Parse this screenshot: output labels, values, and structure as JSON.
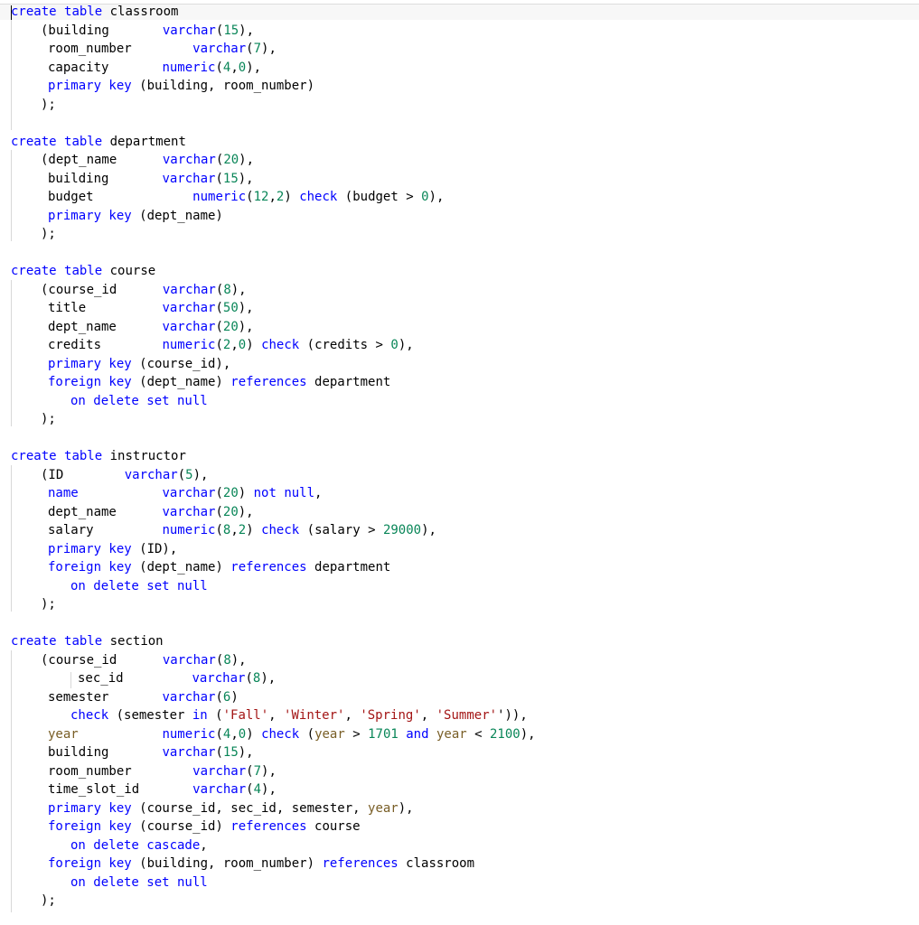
{
  "colors": {
    "background": "#ffffff",
    "text": "#000000",
    "keyword": "#0000ff",
    "number": "#098658",
    "string": "#a31515",
    "variable": "#795e26",
    "indent_guide": "#d8d8d8"
  },
  "editor": {
    "language": "sql",
    "lines": [
      {
        "x": 12,
        "tokens": [
          [
            "kw",
            "create"
          ],
          [
            "txt",
            " "
          ],
          [
            "kw",
            "table"
          ],
          [
            "txt",
            " classroom"
          ]
        ]
      },
      {
        "x": 45,
        "tokens": [
          [
            "txt",
            "(building       "
          ],
          [
            "kw",
            "varchar"
          ],
          [
            "txt",
            "("
          ],
          [
            "num",
            "15"
          ],
          [
            "txt",
            "),"
          ]
        ]
      },
      {
        "x": 53,
        "tokens": [
          [
            "txt",
            "room_number        "
          ],
          [
            "kw",
            "varchar"
          ],
          [
            "txt",
            "("
          ],
          [
            "num",
            "7"
          ],
          [
            "txt",
            "),"
          ]
        ]
      },
      {
        "x": 53,
        "tokens": [
          [
            "txt",
            "capacity       "
          ],
          [
            "kw",
            "numeric"
          ],
          [
            "txt",
            "("
          ],
          [
            "num",
            "4"
          ],
          [
            "txt",
            ","
          ],
          [
            "num",
            "0"
          ],
          [
            "txt",
            "),"
          ]
        ]
      },
      {
        "x": 53,
        "tokens": [
          [
            "kw",
            "primary key"
          ],
          [
            "txt",
            " (building, room_number)"
          ]
        ]
      },
      {
        "x": 45,
        "tokens": [
          [
            "txt",
            ");"
          ]
        ]
      },
      {
        "x": 12,
        "tokens": []
      },
      {
        "x": 12,
        "tokens": [
          [
            "kw",
            "create"
          ],
          [
            "txt",
            " "
          ],
          [
            "kw",
            "table"
          ],
          [
            "txt",
            " department"
          ]
        ]
      },
      {
        "x": 45,
        "tokens": [
          [
            "txt",
            "(dept_name      "
          ],
          [
            "kw",
            "varchar"
          ],
          [
            "txt",
            "("
          ],
          [
            "num",
            "20"
          ],
          [
            "txt",
            "),"
          ]
        ]
      },
      {
        "x": 53,
        "tokens": [
          [
            "txt",
            "building       "
          ],
          [
            "kw",
            "varchar"
          ],
          [
            "txt",
            "("
          ],
          [
            "num",
            "15"
          ],
          [
            "txt",
            "),"
          ]
        ]
      },
      {
        "x": 53,
        "tokens": [
          [
            "txt",
            "budget             "
          ],
          [
            "kw",
            "numeric"
          ],
          [
            "txt",
            "("
          ],
          [
            "num",
            "12"
          ],
          [
            "txt",
            ","
          ],
          [
            "num",
            "2"
          ],
          [
            "txt",
            ") "
          ],
          [
            "kw",
            "check"
          ],
          [
            "txt",
            " (budget > "
          ],
          [
            "num",
            "0"
          ],
          [
            "txt",
            "),"
          ]
        ]
      },
      {
        "x": 53,
        "tokens": [
          [
            "kw",
            "primary key"
          ],
          [
            "txt",
            " (dept_name)"
          ]
        ]
      },
      {
        "x": 45,
        "tokens": [
          [
            "txt",
            ");"
          ]
        ]
      },
      {
        "x": 12,
        "tokens": []
      },
      {
        "x": 12,
        "tokens": [
          [
            "kw",
            "create"
          ],
          [
            "txt",
            " "
          ],
          [
            "kw",
            "table"
          ],
          [
            "txt",
            " course"
          ]
        ]
      },
      {
        "x": 45,
        "tokens": [
          [
            "txt",
            "(course_id      "
          ],
          [
            "kw",
            "varchar"
          ],
          [
            "txt",
            "("
          ],
          [
            "num",
            "8"
          ],
          [
            "txt",
            "),"
          ]
        ]
      },
      {
        "x": 53,
        "tokens": [
          [
            "txt",
            "title          "
          ],
          [
            "kw",
            "varchar"
          ],
          [
            "txt",
            "("
          ],
          [
            "num",
            "50"
          ],
          [
            "txt",
            "),"
          ]
        ]
      },
      {
        "x": 53,
        "tokens": [
          [
            "txt",
            "dept_name      "
          ],
          [
            "kw",
            "varchar"
          ],
          [
            "txt",
            "("
          ],
          [
            "num",
            "20"
          ],
          [
            "txt",
            "),"
          ]
        ]
      },
      {
        "x": 53,
        "tokens": [
          [
            "txt",
            "credits        "
          ],
          [
            "kw",
            "numeric"
          ],
          [
            "txt",
            "("
          ],
          [
            "num",
            "2"
          ],
          [
            "txt",
            ","
          ],
          [
            "num",
            "0"
          ],
          [
            "txt",
            ") "
          ],
          [
            "kw",
            "check"
          ],
          [
            "txt",
            " (credits > "
          ],
          [
            "num",
            "0"
          ],
          [
            "txt",
            "),"
          ]
        ]
      },
      {
        "x": 53,
        "tokens": [
          [
            "kw",
            "primary key"
          ],
          [
            "txt",
            " (course_id),"
          ]
        ]
      },
      {
        "x": 53,
        "tokens": [
          [
            "kw",
            "foreign key"
          ],
          [
            "txt",
            " (dept_name) "
          ],
          [
            "kw",
            "references"
          ],
          [
            "txt",
            " department"
          ]
        ]
      },
      {
        "x": 78,
        "tokens": [
          [
            "kw",
            "on delete set null"
          ]
        ]
      },
      {
        "x": 45,
        "tokens": [
          [
            "txt",
            ");"
          ]
        ]
      },
      {
        "x": 12,
        "tokens": []
      },
      {
        "x": 12,
        "tokens": [
          [
            "kw",
            "create"
          ],
          [
            "txt",
            " "
          ],
          [
            "kw",
            "table"
          ],
          [
            "txt",
            " instructor"
          ]
        ]
      },
      {
        "x": 45,
        "tokens": [
          [
            "txt",
            "(ID        "
          ],
          [
            "kw",
            "varchar"
          ],
          [
            "txt",
            "("
          ],
          [
            "num",
            "5"
          ],
          [
            "txt",
            "),"
          ]
        ]
      },
      {
        "x": 53,
        "tokens": [
          [
            "kw",
            "name"
          ],
          [
            "txt",
            "           "
          ],
          [
            "kw",
            "varchar"
          ],
          [
            "txt",
            "("
          ],
          [
            "num",
            "20"
          ],
          [
            "txt",
            ") "
          ],
          [
            "kw",
            "not null"
          ],
          [
            "txt",
            ","
          ]
        ]
      },
      {
        "x": 53,
        "tokens": [
          [
            "txt",
            "dept_name      "
          ],
          [
            "kw",
            "varchar"
          ],
          [
            "txt",
            "("
          ],
          [
            "num",
            "20"
          ],
          [
            "txt",
            "),"
          ]
        ]
      },
      {
        "x": 53,
        "tokens": [
          [
            "txt",
            "salary         "
          ],
          [
            "kw",
            "numeric"
          ],
          [
            "txt",
            "("
          ],
          [
            "num",
            "8"
          ],
          [
            "txt",
            ","
          ],
          [
            "num",
            "2"
          ],
          [
            "txt",
            ") "
          ],
          [
            "kw",
            "check"
          ],
          [
            "txt",
            " (salary > "
          ],
          [
            "num",
            "29000"
          ],
          [
            "txt",
            "),"
          ]
        ]
      },
      {
        "x": 53,
        "tokens": [
          [
            "kw",
            "primary key"
          ],
          [
            "txt",
            " (ID),"
          ]
        ]
      },
      {
        "x": 53,
        "tokens": [
          [
            "kw",
            "foreign key"
          ],
          [
            "txt",
            " (dept_name) "
          ],
          [
            "kw",
            "references"
          ],
          [
            "txt",
            " department"
          ]
        ]
      },
      {
        "x": 78,
        "tokens": [
          [
            "kw",
            "on delete set null"
          ]
        ]
      },
      {
        "x": 45,
        "tokens": [
          [
            "txt",
            ");"
          ]
        ]
      },
      {
        "x": 12,
        "tokens": []
      },
      {
        "x": 12,
        "tokens": [
          [
            "kw",
            "create"
          ],
          [
            "txt",
            " "
          ],
          [
            "kw",
            "table"
          ],
          [
            "txt",
            " section"
          ]
        ]
      },
      {
        "x": 45,
        "tokens": [
          [
            "txt",
            "(course_id      "
          ],
          [
            "kw",
            "varchar"
          ],
          [
            "txt",
            "("
          ],
          [
            "num",
            "8"
          ],
          [
            "txt",
            "),"
          ]
        ]
      },
      {
        "x": 86,
        "tokens": [
          [
            "txt",
            "sec_id         "
          ],
          [
            "kw",
            "varchar"
          ],
          [
            "txt",
            "("
          ],
          [
            "num",
            "8"
          ],
          [
            "txt",
            "),"
          ]
        ]
      },
      {
        "x": 53,
        "tokens": [
          [
            "txt",
            "semester       "
          ],
          [
            "kw",
            "varchar"
          ],
          [
            "txt",
            "("
          ],
          [
            "num",
            "6"
          ],
          [
            "txt",
            ")"
          ]
        ]
      },
      {
        "x": 78,
        "tokens": [
          [
            "kw",
            "check"
          ],
          [
            "txt",
            " (semester "
          ],
          [
            "kw",
            "in"
          ],
          [
            "txt",
            " ("
          ],
          [
            "str",
            "'Fall'"
          ],
          [
            "txt",
            ", "
          ],
          [
            "str",
            "'Winter'"
          ],
          [
            "txt",
            ", "
          ],
          [
            "str",
            "'Spring'"
          ],
          [
            "txt",
            ", "
          ],
          [
            "str",
            "'Summer'"
          ],
          [
            "txt",
            "')),"
          ]
        ]
      },
      {
        "x": 53,
        "tokens": [
          [
            "var",
            "year"
          ],
          [
            "txt",
            "           "
          ],
          [
            "kw",
            "numeric"
          ],
          [
            "txt",
            "("
          ],
          [
            "num",
            "4"
          ],
          [
            "txt",
            ","
          ],
          [
            "num",
            "0"
          ],
          [
            "txt",
            ") "
          ],
          [
            "kw",
            "check"
          ],
          [
            "txt",
            " ("
          ],
          [
            "var",
            "year"
          ],
          [
            "txt",
            " > "
          ],
          [
            "num",
            "1701"
          ],
          [
            "txt",
            " "
          ],
          [
            "kw",
            "and"
          ],
          [
            "txt",
            " "
          ],
          [
            "var",
            "year"
          ],
          [
            "txt",
            " < "
          ],
          [
            "num",
            "2100"
          ],
          [
            "txt",
            "),"
          ]
        ]
      },
      {
        "x": 53,
        "tokens": [
          [
            "txt",
            "building       "
          ],
          [
            "kw",
            "varchar"
          ],
          [
            "txt",
            "("
          ],
          [
            "num",
            "15"
          ],
          [
            "txt",
            "),"
          ]
        ]
      },
      {
        "x": 53,
        "tokens": [
          [
            "txt",
            "room_number        "
          ],
          [
            "kw",
            "varchar"
          ],
          [
            "txt",
            "("
          ],
          [
            "num",
            "7"
          ],
          [
            "txt",
            "),"
          ]
        ]
      },
      {
        "x": 53,
        "tokens": [
          [
            "txt",
            "time_slot_id       "
          ],
          [
            "kw",
            "varchar"
          ],
          [
            "txt",
            "("
          ],
          [
            "num",
            "4"
          ],
          [
            "txt",
            "),"
          ]
        ]
      },
      {
        "x": 53,
        "tokens": [
          [
            "kw",
            "primary key"
          ],
          [
            "txt",
            " (course_id, sec_id, semester, "
          ],
          [
            "var",
            "year"
          ],
          [
            "txt",
            "),"
          ]
        ]
      },
      {
        "x": 53,
        "tokens": [
          [
            "kw",
            "foreign key"
          ],
          [
            "txt",
            " (course_id) "
          ],
          [
            "kw",
            "references"
          ],
          [
            "txt",
            " course"
          ]
        ]
      },
      {
        "x": 78,
        "tokens": [
          [
            "kw",
            "on delete cascade"
          ],
          [
            "txt",
            ","
          ]
        ]
      },
      {
        "x": 53,
        "tokens": [
          [
            "kw",
            "foreign key"
          ],
          [
            "txt",
            " (building, room_number) "
          ],
          [
            "kw",
            "references"
          ],
          [
            "txt",
            " classroom"
          ]
        ]
      },
      {
        "x": 78,
        "tokens": [
          [
            "kw",
            "on delete set null"
          ]
        ]
      },
      {
        "x": 45,
        "tokens": [
          [
            "txt",
            ");"
          ]
        ]
      }
    ]
  }
}
